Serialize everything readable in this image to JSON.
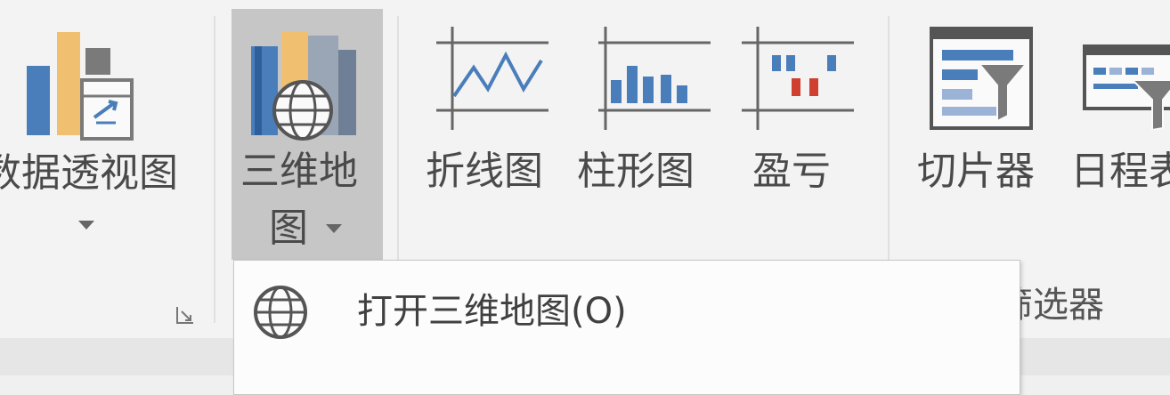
{
  "ribbon": {
    "pivot_chart": {
      "label": "数据透视图"
    },
    "map3d": {
      "label_line1": "三维地",
      "label_line2": "图"
    },
    "sparklines": {
      "line": {
        "label": "折线图"
      },
      "column": {
        "label": "柱形图"
      },
      "winloss": {
        "label": "盈亏"
      }
    },
    "filters": {
      "slicer": {
        "label": "切片器"
      },
      "timeline": {
        "label": "日程表"
      },
      "group_label": "筛选器"
    }
  },
  "dropdown": {
    "items": [
      {
        "label": "打开三维地图(O)",
        "icon": "globe-icon"
      }
    ]
  },
  "colors": {
    "blue": "#4a7ebb",
    "orange": "#f0c070",
    "gray": "#8a8a8a",
    "red": "#d04030",
    "pressed": "#c6c6c6"
  }
}
